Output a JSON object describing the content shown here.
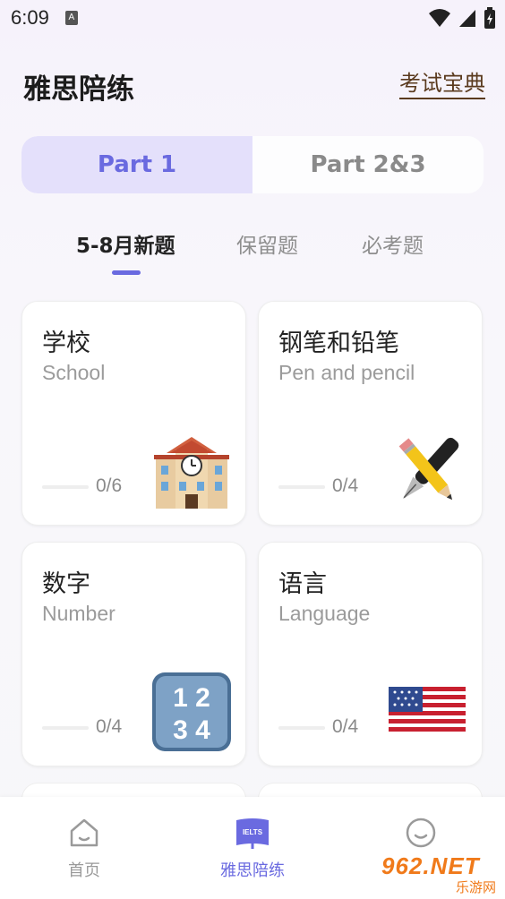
{
  "status_bar": {
    "time": "6:09",
    "a_icon_label": "A",
    "icons": [
      "wifi-icon",
      "signal-icon",
      "battery-icon"
    ]
  },
  "header": {
    "title": "雅思陪练",
    "guide_link": "考试宝典"
  },
  "part_tabs": [
    {
      "label": "Part 1",
      "active": true
    },
    {
      "label": "Part 2&3",
      "active": false
    }
  ],
  "sub_tabs": [
    {
      "label": "5-8月新题",
      "active": true
    },
    {
      "label": "保留题",
      "active": false
    },
    {
      "label": "必考题",
      "active": false
    }
  ],
  "cards": [
    {
      "title": "学校",
      "subtitle": "School",
      "progress": "0/6",
      "icon": "school-building-icon"
    },
    {
      "title": "钢笔和铅笔",
      "subtitle": "Pen and pencil",
      "progress": "0/4",
      "icon": "pen-and-pencil-icon"
    },
    {
      "title": "数字",
      "subtitle": "Number",
      "progress": "0/4",
      "icon": "numbers-1234-icon"
    },
    {
      "title": "语言",
      "subtitle": "Language",
      "progress": "0/4",
      "icon": "us-flag-icon"
    }
  ],
  "numbers_icon_text": {
    "row1": "1 2",
    "row2": "3 4"
  },
  "bottom_nav": [
    {
      "label": "首页",
      "icon": "home-icon",
      "active": false
    },
    {
      "label": "雅思陪练",
      "icon": "ielts-book-icon",
      "active": true,
      "badge": "IELTS"
    },
    {
      "label": "",
      "icon": "profile-face-icon",
      "active": false
    }
  ],
  "watermark": {
    "main": "962.NET",
    "sub": "乐游网"
  },
  "colors": {
    "accent": "#6a6ae0",
    "active_tab_bg": "#e4e0fb",
    "link_brown": "#5a3a1e",
    "watermark_orange": "#f07a1a"
  }
}
